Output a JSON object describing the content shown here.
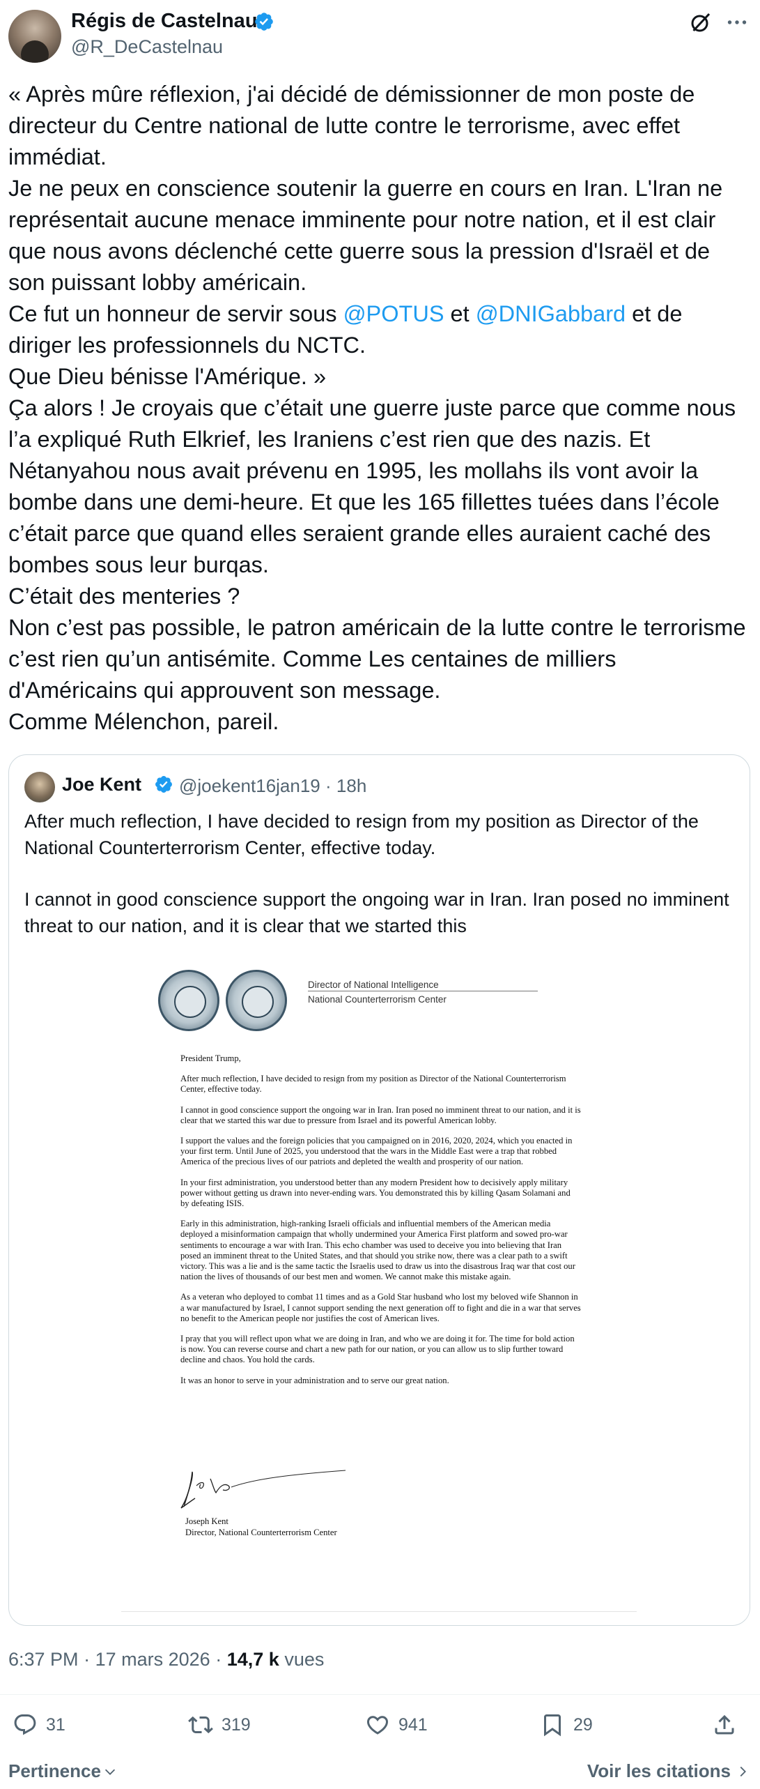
{
  "author": {
    "name": "Régis de Castelnau",
    "handle": "@R_DeCastelnau"
  },
  "tweet": {
    "lines": [
      "« Après mûre réflexion, j'ai décidé de démissionner de mon poste de directeur du Centre national de lutte contre le terrorisme, avec effet immédiat.",
      "Je ne peux en conscience soutenir la guerre en cours en Iran. L'Iran ne représentait aucune menace imminente pour notre nation, et il est clair que nous avons déclenché cette guerre sous la pression d'Israël et de son puissant lobby américain."
    ],
    "line3_pre": "Ce fut un honneur de servir sous ",
    "mention1": "@POTUS",
    "line3_mid": " et ",
    "mention2": "@DNIGabbard",
    "line3_post": " et de diriger les professionnels du NCTC.",
    "lines_after": [
      "Que Dieu bénisse l'Amérique. »",
      "Ça alors ! Je croyais que c’était une guerre juste parce que comme nous l’a expliqué Ruth Elkrief, les Iraniens c’est rien que des nazis. Et Nétanyahou nous avait prévenu en 1995, les mollahs ils vont avoir la bombe dans une demi-heure. Et que les 165 fillettes tuées dans l’école c’était parce que quand elles seraient grande elles auraient caché des bombes sous leur burqas.",
      "C’était des menteries ?",
      "Non c’est pas possible, le patron américain de la lutte contre le terrorisme c’est rien qu’un antisémite. Comme Les centaines de milliers d'Américains qui approuvent son message.",
      "Comme Mélenchon, pareil."
    ]
  },
  "quote": {
    "name": "Joe Kent",
    "handle": "@joekent16jan19",
    "separator": "·",
    "age": "18h",
    "paragraph1": "After much reflection, I have decided to resign from my position as Director of the National Counterterrorism Center, effective today.",
    "paragraph2": "I cannot in good conscience support the ongoing war in Iran. Iran posed no imminent threat to our nation, and it is clear that we started this",
    "letter": {
      "header_line1": "Director of National Intelligence",
      "header_line2": "National Counterterrorism Center",
      "paragraphs": [
        "President Trump,",
        "After much reflection, I have decided to resign from my position as Director of the National Counterterrorism Center, effective today.",
        "I cannot in good conscience support the ongoing war in Iran. Iran posed no imminent threat to our nation, and it is clear that we started this war due to pressure from Israel and its powerful American lobby.",
        "I support the values and the foreign policies that you campaigned on in 2016, 2020, 2024, which you enacted in your first term. Until June of 2025, you understood that the wars in the Middle East were a trap that robbed America of the precious lives of our patriots and depleted the wealth and prosperity of our nation.",
        "In your first administration, you understood better than any modern President how to decisively apply military power without getting us drawn into never-ending wars. You demonstrated this by killing Qasam Solamani and by defeating ISIS.",
        "Early in this administration, high-ranking Israeli officials and influential members of the American media deployed a misinformation campaign that wholly undermined your America First platform and sowed pro-war sentiments to encourage a war with Iran. This echo chamber was used to deceive you into believing that Iran posed an imminent threat to the United States, and that should you strike now, there was a clear path to a swift victory. This was a lie and is the same tactic the Israelis used to draw us into the disastrous Iraq war that cost our nation the lives of thousands of our best men and women. We cannot make this mistake again.",
        "As a veteran who deployed to combat 11 times and as a Gold Star husband who lost my beloved wife Shannon in a war manufactured by Israel, I cannot support sending the next generation off to fight and die in a war that serves no benefit to the American people nor justifies the cost of American lives.",
        "I pray that you will reflect upon what we are doing in Iran, and who we are doing it for. The time for bold action is now. You can reverse course and chart a new path for our nation, or you can allow us to slip further toward decline and chaos. You hold the cards.",
        "It was an honor to serve in your administration and to serve our great nation."
      ],
      "signer_name": "Joseph Kent",
      "signer_title": "Director, National Counterterrorism Center"
    }
  },
  "meta": {
    "time": "6:37 PM",
    "separator": "·",
    "date": "17 mars 2026",
    "views_count": "14,7 k",
    "views_label": "vues"
  },
  "actions": {
    "replies": "31",
    "reposts": "319",
    "likes": "941",
    "bookmarks": "29"
  },
  "footer": {
    "sort_label": "Pertinence",
    "quotes_label": "Voir les citations"
  },
  "colors": {
    "text": "#0f1419",
    "secondary": "#536471",
    "link": "#1d9bf0",
    "verified": "#1d9bf0",
    "border": "#cfd9de"
  }
}
